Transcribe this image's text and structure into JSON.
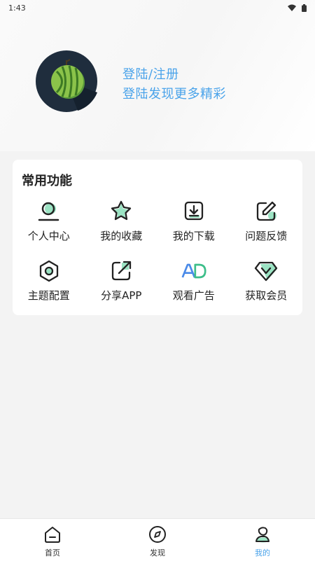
{
  "status_bar": {
    "time": "1:43",
    "wifi_icon": "wifi-icon",
    "battery_icon": "battery-icon"
  },
  "profile": {
    "avatar_icon": "watermelon-avatar",
    "login_label": "登陆/注册",
    "login_subtitle": "登陆发现更多精彩",
    "accent_color": "#4aa3ea"
  },
  "functions": {
    "title": "常用功能",
    "items": [
      {
        "label": "个人中心",
        "icon": "person-icon"
      },
      {
        "label": "我的收藏",
        "icon": "star-icon"
      },
      {
        "label": "我的下载",
        "icon": "download-icon"
      },
      {
        "label": "问题反馈",
        "icon": "feedback-icon"
      },
      {
        "label": "主题配置",
        "icon": "theme-icon"
      },
      {
        "label": "分享APP",
        "icon": "share-icon"
      },
      {
        "label": "观看广告",
        "icon": "ad-icon"
      },
      {
        "label": "获取会员",
        "icon": "vip-icon"
      }
    ]
  },
  "tabbar": {
    "tabs": [
      {
        "label": "首页",
        "icon": "home-icon",
        "active": false
      },
      {
        "label": "发现",
        "icon": "compass-icon",
        "active": false
      },
      {
        "label": "我的",
        "icon": "profile-icon",
        "active": true
      }
    ],
    "active_color": "#4aa3ea"
  }
}
